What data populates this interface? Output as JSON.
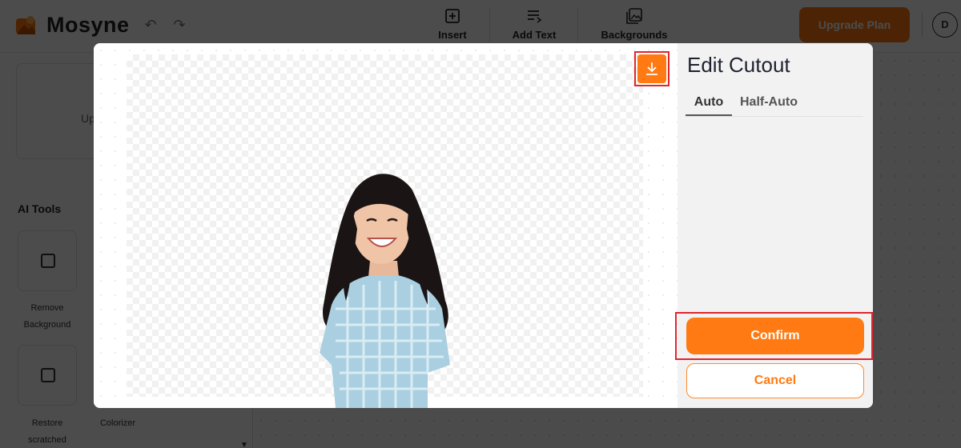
{
  "app": {
    "brand": "Mosyne",
    "toolbar": {
      "insert_label": "Insert",
      "add_text_label": "Add Text",
      "backgrounds_label": "Backgrounds"
    },
    "upgrade_label": "Upgrade Plan",
    "avatar_initial": "D",
    "accent_color": "#ff7a12"
  },
  "sidebar": {
    "upload_text": "Up",
    "ai_tools_title": "AI Tools",
    "tools": [
      {
        "label_line1": "Remove",
        "label_line2": "Background",
        "icon": "image-icon"
      },
      {
        "label_line1": "Restore",
        "label_line2": "scratched",
        "icon": "image-restore-icon"
      },
      {
        "label_line1": "Colorizer",
        "label_line2": "",
        "icon": "palette-icon"
      }
    ]
  },
  "modal": {
    "title": "Edit Cutout",
    "tabs": [
      {
        "label": "Auto",
        "active": true
      },
      {
        "label": "Half-Auto",
        "active": false
      }
    ],
    "confirm_label": "Confirm",
    "cancel_label": "Cancel",
    "download_icon": "download-icon",
    "highlight_color": "#e1252c"
  }
}
